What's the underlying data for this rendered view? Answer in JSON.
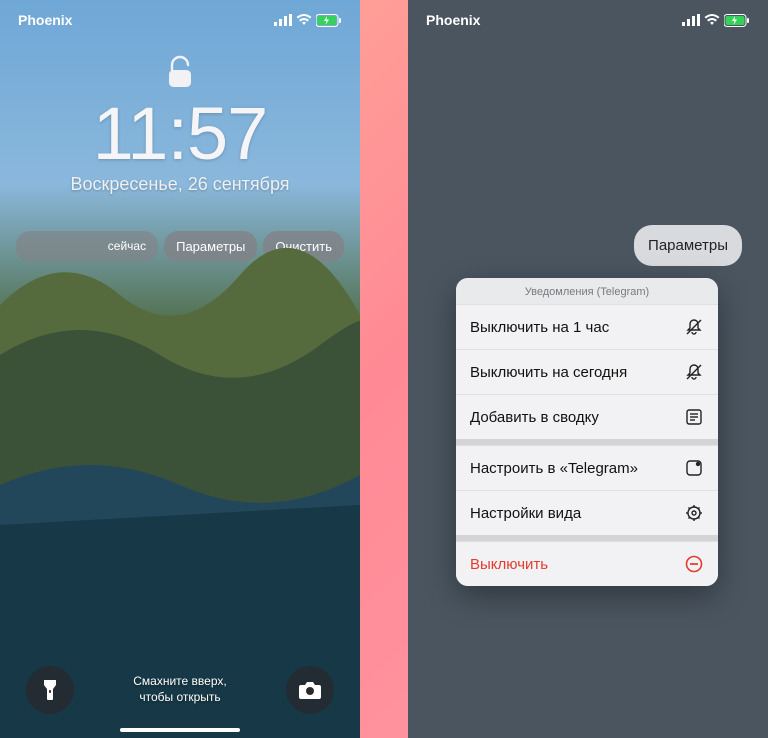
{
  "left": {
    "carrier": "Phoenix",
    "time": "11:57",
    "date": "Воскресенье, 26 сентября",
    "pills": {
      "now": "сейчас",
      "params": "Параметры",
      "clear": "Очистить"
    },
    "swipe_hint_l1": "Смахните вверх,",
    "swipe_hint_l2": "чтобы открыть"
  },
  "right": {
    "carrier": "Phoenix",
    "params_bubble": "Параметры",
    "menu_header": "Уведомления (Telegram)",
    "items": [
      {
        "label": "Выключить на 1 час"
      },
      {
        "label": "Выключить на сегодня"
      },
      {
        "label": "Добавить в сводку"
      }
    ],
    "items2": [
      {
        "label": "Настроить в «Telegram»"
      },
      {
        "label": "Настройки вида"
      }
    ],
    "destructive": {
      "label": "Выключить"
    }
  }
}
